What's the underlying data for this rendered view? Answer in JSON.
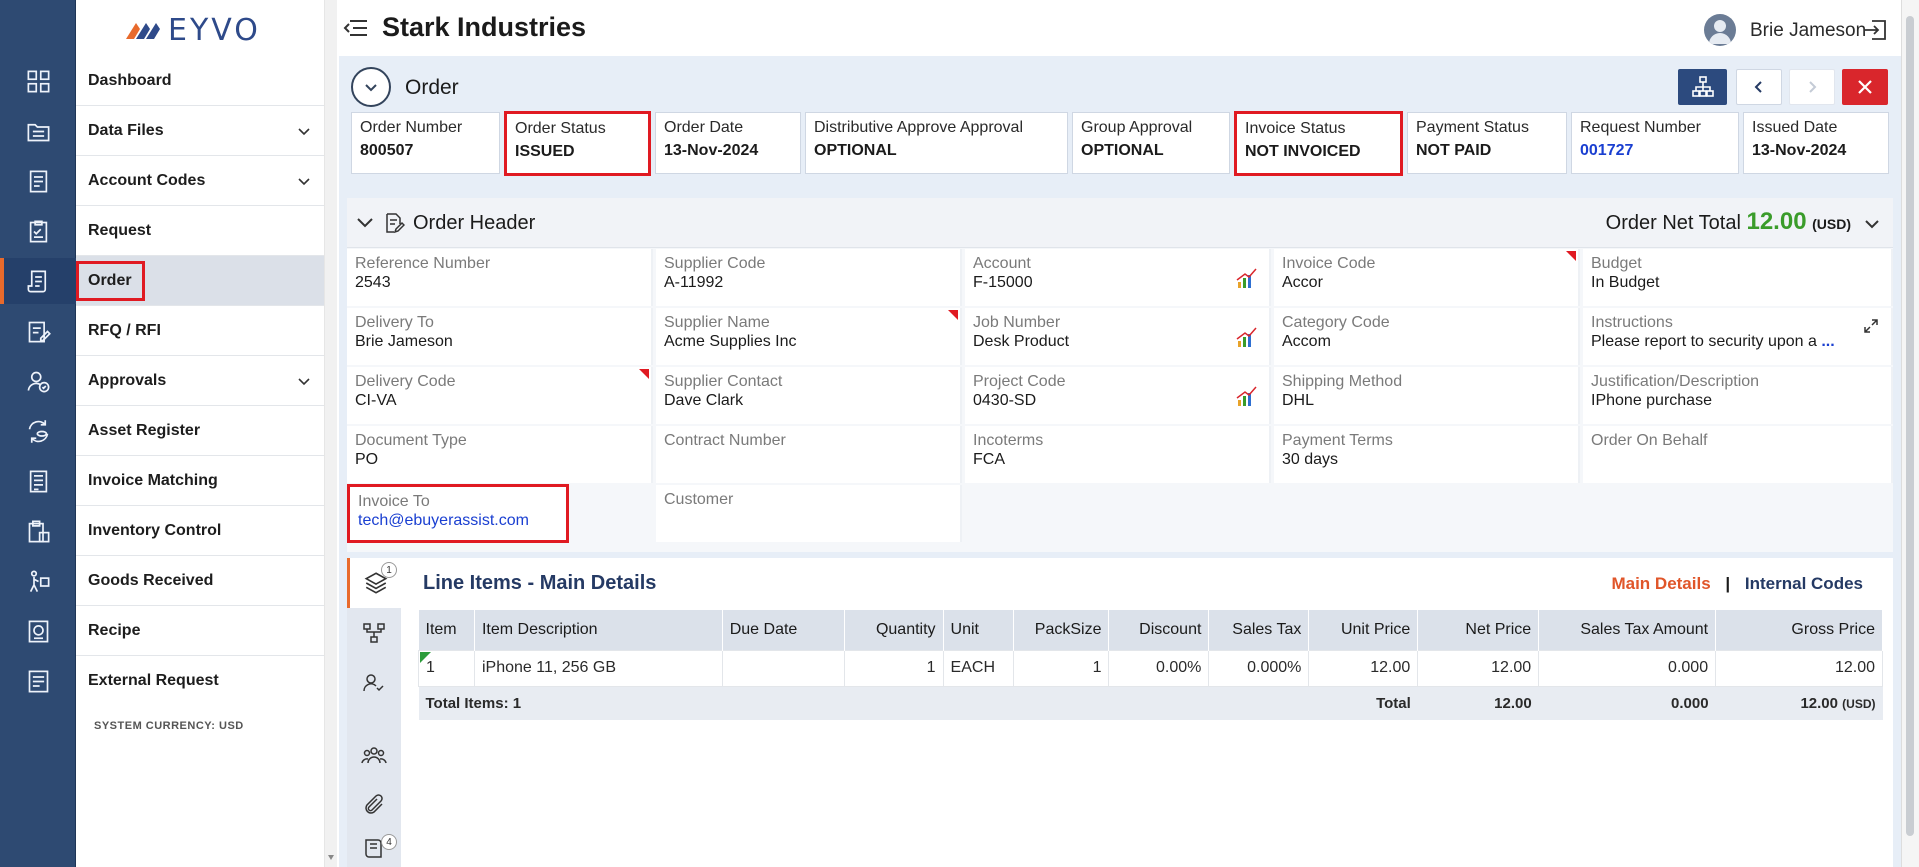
{
  "brand": {
    "logo_text": "EYVO"
  },
  "topbar": {
    "company": "Stark Industries",
    "user": "Brie Jameson"
  },
  "sidebar": {
    "items": [
      {
        "label": "Dashboard"
      },
      {
        "label": "Data Files"
      },
      {
        "label": "Account Codes"
      },
      {
        "label": "Request"
      },
      {
        "label": "Order"
      },
      {
        "label": "RFQ / RFI"
      },
      {
        "label": "Approvals"
      },
      {
        "label": "Asset Register"
      },
      {
        "label": "Invoice Matching"
      },
      {
        "label": "Inventory Control"
      },
      {
        "label": "Goods Received"
      },
      {
        "label": "Recipe"
      },
      {
        "label": "External Request"
      }
    ],
    "system_currency": "SYSTEM CURRENCY: USD"
  },
  "order": {
    "title": "Order",
    "cards": [
      {
        "label": "Order Number",
        "value": "800507"
      },
      {
        "label": "Order Status",
        "value": "ISSUED"
      },
      {
        "label": "Order Date",
        "value": "13-Nov-2024"
      },
      {
        "label": "Distributive Approve Approval",
        "value": "OPTIONAL"
      },
      {
        "label": "Group Approval",
        "value": "OPTIONAL"
      },
      {
        "label": "Invoice Status",
        "value": "NOT INVOICED"
      },
      {
        "label": "Payment Status",
        "value": "NOT PAID"
      },
      {
        "label": "Request Number",
        "value": "001727"
      },
      {
        "label": "Issued Date",
        "value": "13-Nov-2024"
      }
    ]
  },
  "order_header": {
    "title": "Order Header",
    "net_total_label": "Order Net Total",
    "net_total_value": "12.00",
    "net_total_currency": "(USD)",
    "fields": [
      {
        "label": "Reference Number",
        "value": "2543"
      },
      {
        "label": "Supplier Code",
        "value": "A-11992"
      },
      {
        "label": "Account",
        "value": "F-15000"
      },
      {
        "label": "Invoice Code",
        "value": "Accor"
      },
      {
        "label": "Budget",
        "value": "In Budget"
      },
      {
        "label": "Delivery To",
        "value": "Brie Jameson"
      },
      {
        "label": "Supplier Name",
        "value": "Acme Supplies Inc"
      },
      {
        "label": "Job Number",
        "value": "Desk Product"
      },
      {
        "label": "Category Code",
        "value": "Accom"
      },
      {
        "label": "Instructions",
        "value": "Please report to security upon a"
      },
      {
        "label": "Delivery Code",
        "value": "CI-VA"
      },
      {
        "label": "Supplier Contact",
        "value": "Dave Clark"
      },
      {
        "label": "Project Code",
        "value": "0430-SD"
      },
      {
        "label": "Shipping Method",
        "value": "DHL"
      },
      {
        "label": "Justification/Description",
        "value": "IPhone purchase"
      },
      {
        "label": "Document Type",
        "value": "PO"
      },
      {
        "label": "Contract Number",
        "value": ""
      },
      {
        "label": "Incoterms",
        "value": "FCA"
      },
      {
        "label": "Payment Terms",
        "value": "30 days"
      },
      {
        "label": "Order On Behalf",
        "value": ""
      },
      {
        "label": "Invoice To",
        "value": "tech@ebuyerassist.com"
      },
      {
        "label": "Customer",
        "value": ""
      }
    ],
    "more_marker": "..."
  },
  "line_items": {
    "title": "Line Items - Main Details",
    "link_main": "Main Details",
    "link_sep": "|",
    "link_internal": "Internal Codes",
    "tab_badges": {
      "details": "1",
      "docs": "4"
    },
    "columns": [
      "Item",
      "Item Description",
      "Due Date",
      "Quantity",
      "Unit",
      "PackSize",
      "Discount",
      "Sales Tax",
      "Unit Price",
      "Net Price",
      "Sales Tax Amount",
      "Gross Price"
    ],
    "rows": [
      [
        "1",
        "iPhone 11, 256 GB",
        "",
        "1",
        "EACH",
        "1",
        "0.00%",
        "0.000%",
        "12.00",
        "12.00",
        "0.000",
        "12.00"
      ]
    ],
    "totals": {
      "items": "Total Items: 1",
      "label": "Total",
      "net": "12.00",
      "tax": "0.000",
      "gross": "12.00",
      "gross_currency": "(USD)"
    }
  },
  "colors": {
    "rail": "#2e4a72",
    "highlight": "#e01a22",
    "accent": "#e86a2c",
    "total_green": "#3a9c2a"
  }
}
